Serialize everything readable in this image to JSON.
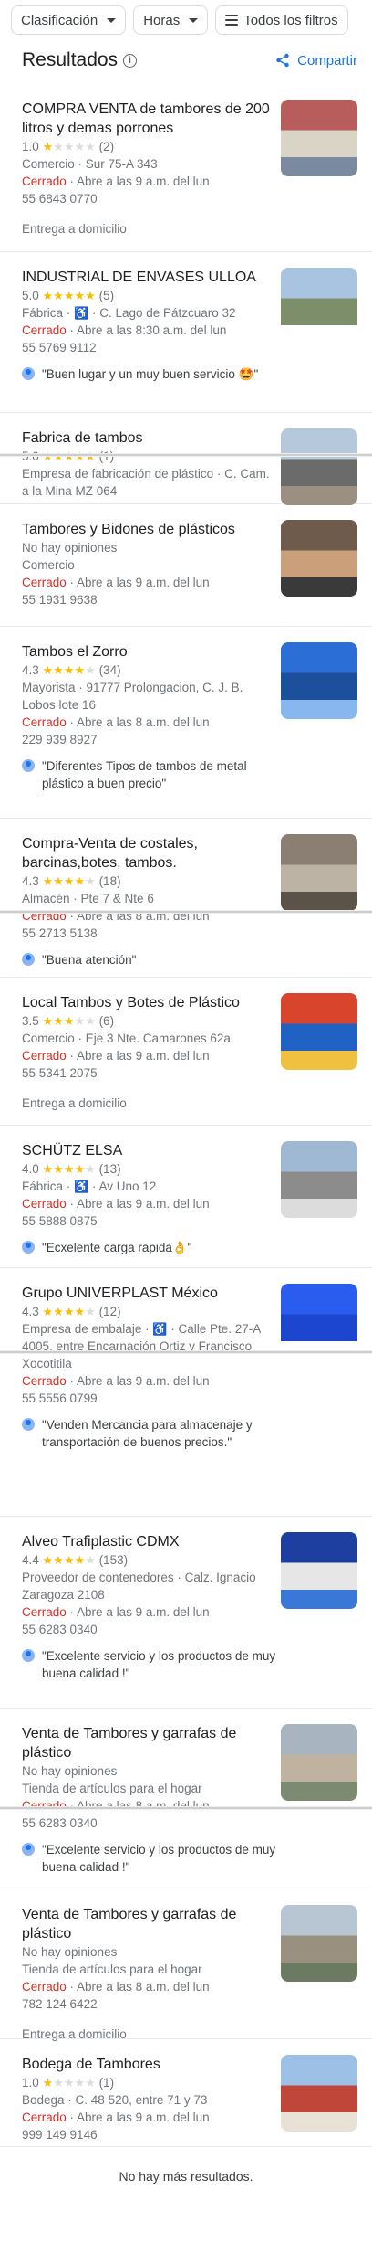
{
  "filters": {
    "clasificacion": "Clasificación",
    "horas": "Horas",
    "todos": "Todos los filtros"
  },
  "header": {
    "title": "Resultados",
    "share": "Compartir"
  },
  "results": [
    {
      "name": "COMPRA VENTA de tambores de 200 litros y demas porrones",
      "rating": "1.0",
      "stars": 1,
      "reviews": "(2)",
      "type": "Comercio",
      "wheelchair": false,
      "address": "Sur 75-A 343",
      "closed": "Cerrado",
      "opens": "Abre a las 9 a.m. del lun",
      "phone": "55 6843 0770",
      "extra": "Entrega a domicilio",
      "review": ""
    },
    {
      "name": "INDUSTRIAL DE ENVASES ULLOA",
      "rating": "5.0",
      "stars": 5,
      "reviews": "(5)",
      "type": "Fábrica",
      "wheelchair": true,
      "address": "C. Lago de Pátzcuaro 32",
      "closed": "Cerrado",
      "opens": "Abre a las 8:30 a.m. del lun",
      "phone": "55 5769 9112",
      "extra": "",
      "review": "\"Buen lugar y un muy buen servicio 🤩\""
    },
    {
      "name": "Fabrica de tambos",
      "rating": "5.0",
      "stars": 5,
      "reviews": "(1)",
      "type": "Empresa de fabricación de plástico",
      "wheelchair": false,
      "address": "C. Cam. a la Mina MZ 064",
      "closed": "",
      "opens": "",
      "phone": "",
      "extra": "",
      "review": ""
    },
    {
      "name": "Tambores y Bidones de plásticos",
      "rating": "",
      "stars": 0,
      "reviews": "No hay opiniones",
      "type": "Comercio",
      "wheelchair": false,
      "address": "",
      "closed": "Cerrado",
      "opens": "Abre a las 9 a.m. del lun",
      "phone": "55 1931 9638",
      "extra": "",
      "review": ""
    },
    {
      "name": "Tambos el Zorro",
      "rating": "4.3",
      "stars": 4,
      "reviews": "(34)",
      "type": "Mayorista",
      "wheelchair": false,
      "address": "91777 Prolongacion, C. J. B. Lobos lote 16",
      "closed": "Cerrado",
      "opens": "Abre a las 8 a.m. del lun",
      "phone": "229 939 8927",
      "extra": "",
      "review": "\"Diferentes Tipos de tambos de metal plástico a buen precio\""
    },
    {
      "name": "Compra-Venta de costales, barcinas,botes, tambos.",
      "rating": "4.3",
      "stars": 4,
      "reviews": "(18)",
      "type": "Almacén",
      "wheelchair": false,
      "address": "Pte 7 & Nte 6",
      "closed": "Cerrado",
      "opens": "Abre a las 8 a.m. del lun",
      "phone": "55 2713 5138",
      "extra": "",
      "review": "\"Buena atención\""
    },
    {
      "name": "Local Tambos y Botes de Plástico",
      "rating": "3.5",
      "stars": 3,
      "reviews": "(6)",
      "type": "Comercio",
      "wheelchair": false,
      "address": "Eje 3 Nte. Camarones 62a",
      "closed": "Cerrado",
      "opens": "Abre a las 9 a.m. del lun",
      "phone": "55 5341 2075",
      "extra": "Entrega a domicilio",
      "review": ""
    },
    {
      "name": "SCHÜTZ ELSA",
      "rating": "4.0",
      "stars": 4,
      "reviews": "(13)",
      "type": "Fábrica",
      "wheelchair": true,
      "address": "Av Uno 12",
      "closed": "Cerrado",
      "opens": "Abre a las 9 a.m. del lun",
      "phone": "55 5888 0875",
      "extra": "",
      "review": "\"Ecxelente carga rapida👌\""
    },
    {
      "name": "Grupo UNIVERPLAST México",
      "rating": "4.3",
      "stars": 4,
      "reviews": "(12)",
      "type": "Empresa de embalaje",
      "wheelchair": true,
      "address": "Calle Pte. 27-A 4005, entre Encarnación Ortiz y Francisco Xocotitila",
      "closed": "Cerrado",
      "opens": "Abre a las 9 a.m. del lun",
      "phone": "55 5556 0799",
      "extra": "",
      "review": "\"Venden Mercancia para almacenaje y transportación de buenos precios.\""
    },
    {
      "name": "Alveo Trafiplastic CDMX",
      "rating": "4.4",
      "stars": 4,
      "reviews": "(153)",
      "type": "Proveedor de contenedores",
      "wheelchair": false,
      "address": "Calz. Ignacio Zaragoza 2108",
      "closed": "Cerrado",
      "opens": "Abre a las 9 a.m. del lun",
      "phone": "55 6283 0340",
      "extra": "",
      "review": "\"Excelente servicio y los productos de muy buena calidad !\""
    },
    {
      "name": "Venta de Tambores y garrafas de plástico",
      "rating": "",
      "stars": 0,
      "reviews": "No hay opiniones",
      "type": "Tienda de artículos para el hogar",
      "wheelchair": false,
      "address": "",
      "closed": "Cerrado",
      "opens": "Abre a las 8 a.m. del lun",
      "phone": "55 6283 0340",
      "extra": "",
      "review": "\"Excelente servicio y los productos de muy buena calidad !\""
    },
    {
      "name": "Venta de Tambores y garrafas de plástico",
      "rating": "",
      "stars": 0,
      "reviews": "No hay opiniones",
      "type": "Tienda de artículos para el hogar",
      "wheelchair": false,
      "address": "",
      "closed": "Cerrado",
      "opens": "Abre a las 8 a.m. del lun",
      "phone": "782 124 6422",
      "extra": "Entrega a domicilio",
      "review": ""
    },
    {
      "name": "Bodega de Tambores",
      "rating": "1.0",
      "stars": 1,
      "reviews": "(1)",
      "type": "Bodega",
      "wheelchair": false,
      "address": "C. 48 520, entre 71 y 73",
      "closed": "Cerrado",
      "opens": "Abre a las 9 a.m. del lun",
      "phone": "999 149 9146",
      "extra": "",
      "review": ""
    }
  ],
  "footer": "No hay más resultados."
}
